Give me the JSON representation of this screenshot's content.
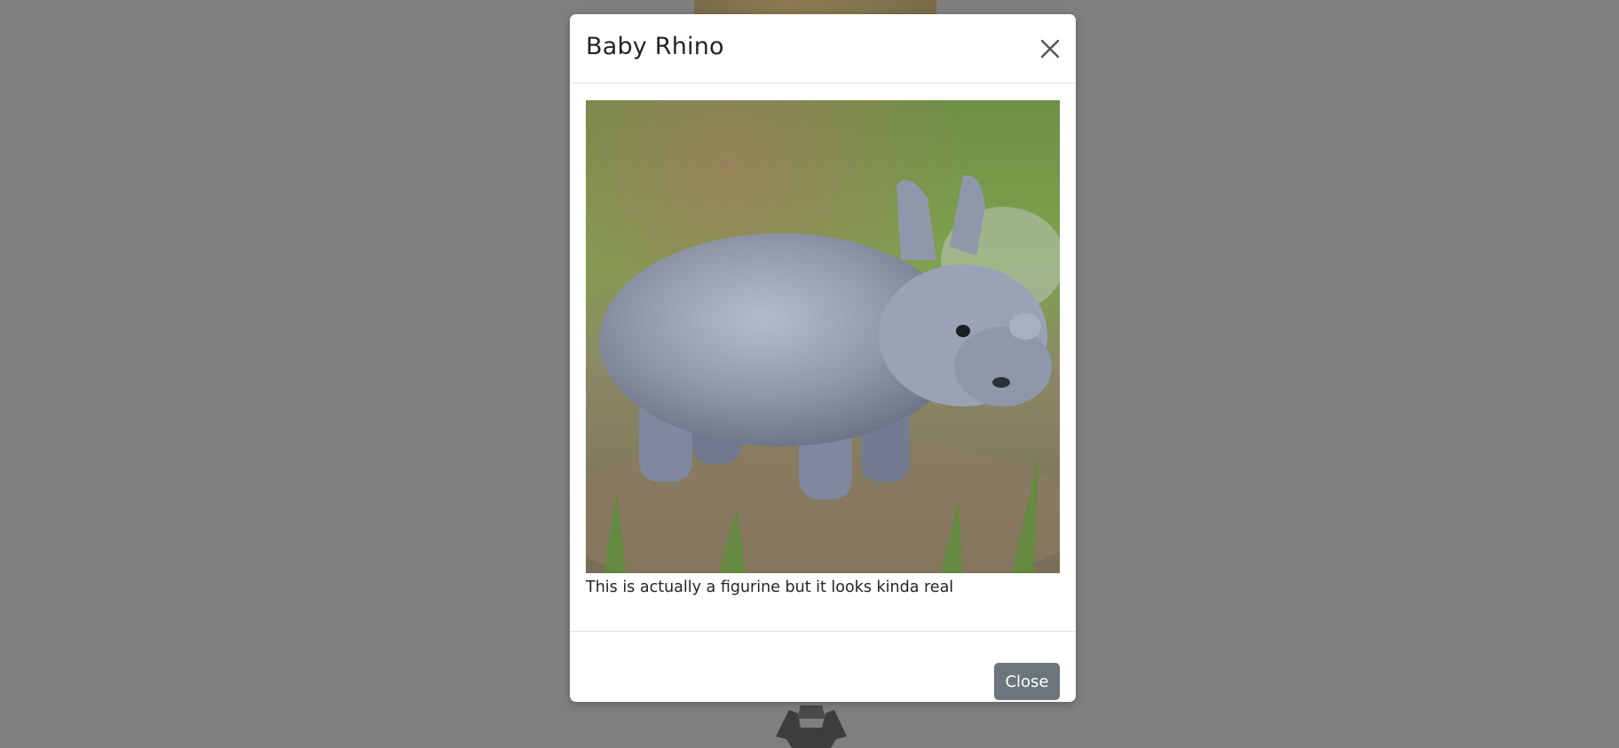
{
  "modal": {
    "title": "Baby Rhino",
    "close_icon": "close-icon",
    "image_alt": "baby rhino figurine on grass",
    "caption": "This is actually a figurine but it looks kinda real",
    "close_button_label": "Close"
  },
  "colors": {
    "backdrop": "#7f7f7f",
    "button": "#6c757d",
    "divider": "#dee2e6",
    "text": "#212529"
  }
}
